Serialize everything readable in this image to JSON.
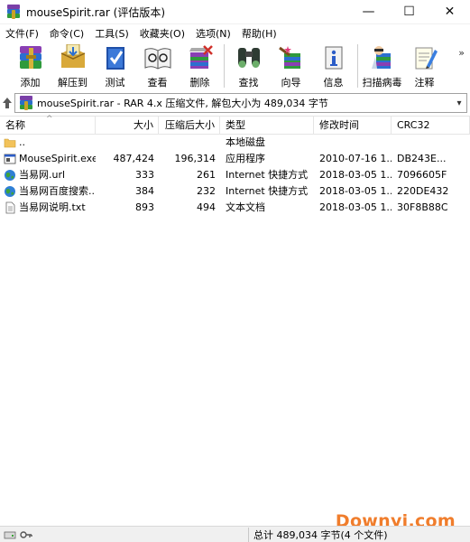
{
  "window": {
    "title": "mouseSpirit.rar (评估版本)",
    "minimize_glyph": "—",
    "maximize_glyph": "☐",
    "close_glyph": "✕"
  },
  "menu": [
    "文件(F)",
    "命令(C)",
    "工具(S)",
    "收藏夹(O)",
    "选项(N)",
    "帮助(H)"
  ],
  "toolbar": {
    "items": [
      {
        "label": "添加",
        "icon": "add-archive-icon"
      },
      {
        "label": "解压到",
        "icon": "extract-to-icon"
      },
      {
        "label": "测试",
        "icon": "test-icon"
      },
      {
        "label": "查看",
        "icon": "view-icon"
      },
      {
        "label": "删除",
        "icon": "delete-icon"
      },
      {
        "label": "查找",
        "icon": "find-icon"
      },
      {
        "label": "向导",
        "icon": "wizard-icon"
      },
      {
        "label": "信息",
        "icon": "info-icon"
      },
      {
        "label": "扫描病毒",
        "icon": "scan-virus-icon"
      },
      {
        "label": "注释",
        "icon": "comment-icon"
      }
    ],
    "more_glyph": "»"
  },
  "address": {
    "text": "mouseSpirit.rar - RAR 4.x 压缩文件, 解包大小为 489,034 字节",
    "dropdown_glyph": "▾"
  },
  "columns": {
    "name": "名称",
    "size": "大小",
    "packed": "压缩后大小",
    "type": "类型",
    "modified": "修改时间",
    "crc": "CRC32",
    "sort_glyph": "^"
  },
  "files": [
    {
      "name": "..",
      "size": "",
      "packed": "",
      "type": "本地磁盘",
      "modified": "",
      "crc": "",
      "icon": "folder-icon"
    },
    {
      "name": "MouseSpirit.exe",
      "size": "487,424",
      "packed": "196,314",
      "type": "应用程序",
      "modified": "2010-07-16 1...",
      "crc": "DB243E...",
      "icon": "exe-icon"
    },
    {
      "name": "当易网.url",
      "size": "333",
      "packed": "261",
      "type": "Internet 快捷方式",
      "modified": "2018-03-05 1...",
      "crc": "7096605F",
      "icon": "globe-icon"
    },
    {
      "name": "当易网百度搜索....",
      "size": "384",
      "packed": "232",
      "type": "Internet 快捷方式",
      "modified": "2018-03-05 1...",
      "crc": "220DE432",
      "icon": "globe-icon"
    },
    {
      "name": "当易网说明.txt",
      "size": "893",
      "packed": "494",
      "type": "文本文档",
      "modified": "2018-03-05 1...",
      "crc": "30F8B88C",
      "icon": "text-file-icon"
    }
  ],
  "status": {
    "text": "总计 489,034 字节(4 个文件)"
  },
  "watermark": {
    "text_a": "D",
    "text_b": "ownyi.com"
  }
}
